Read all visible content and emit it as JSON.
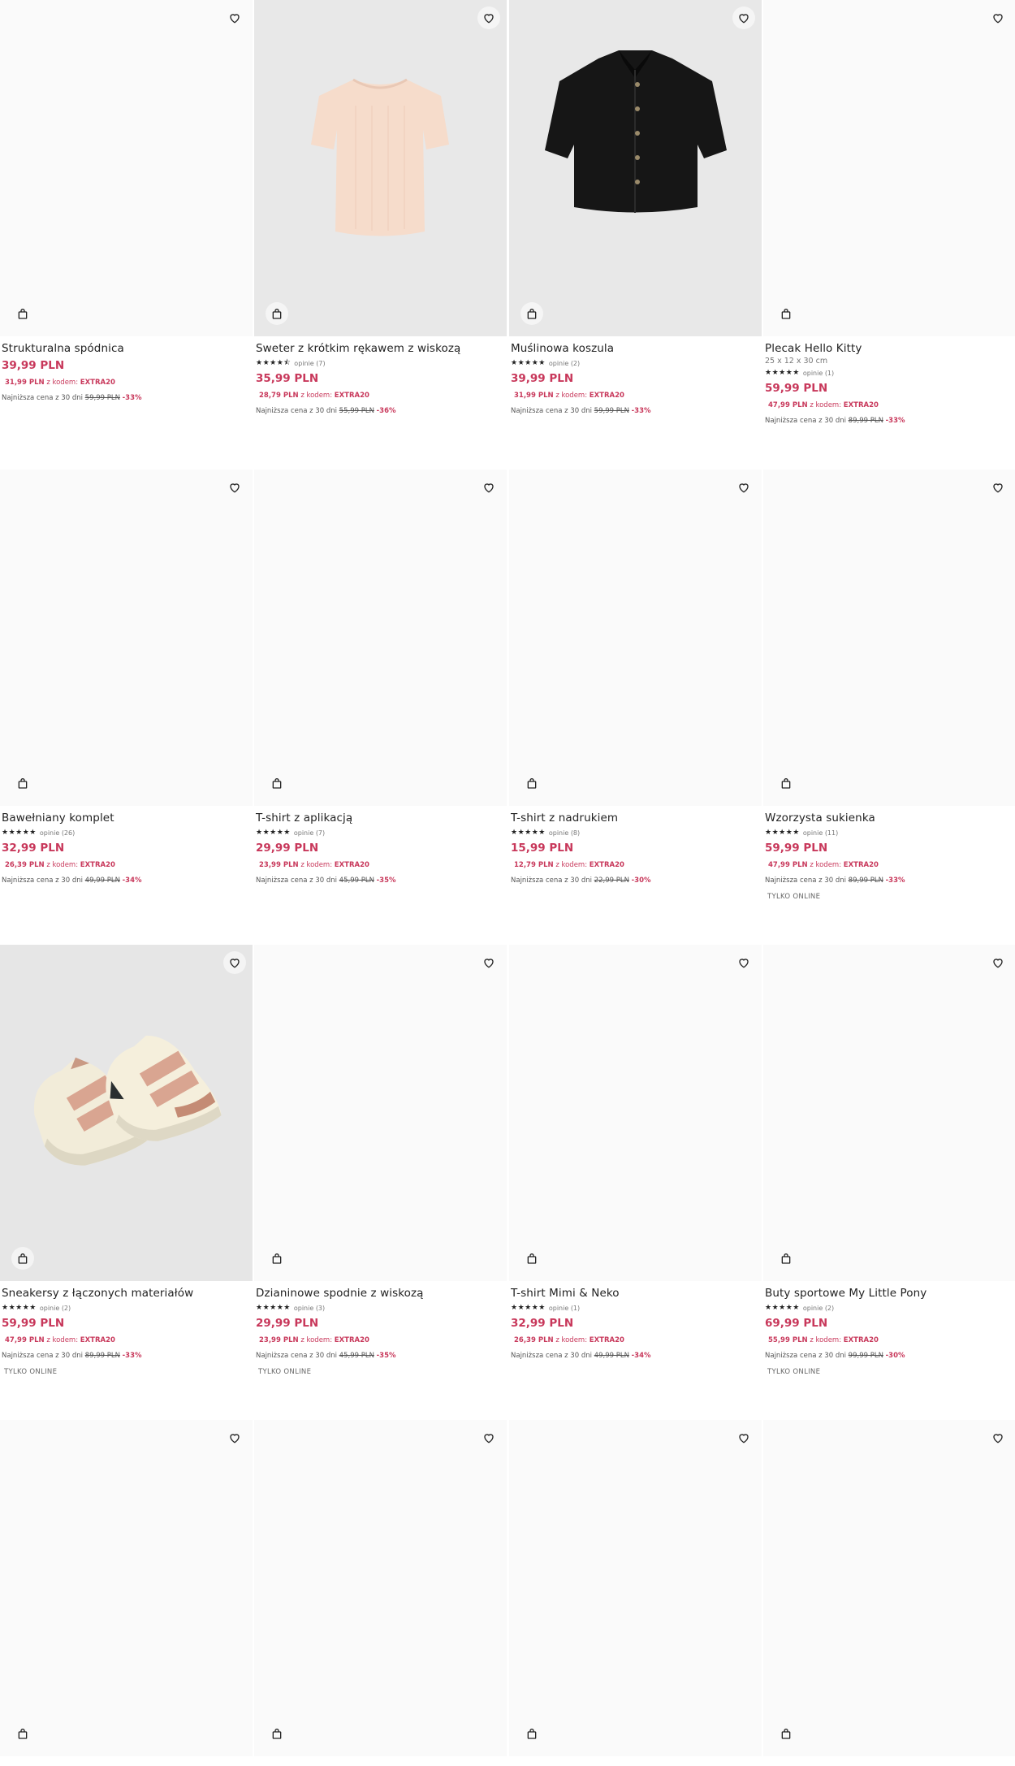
{
  "labels": {
    "reviews_prefix": "opinie",
    "code_prefix": "z kodem:",
    "lowest_prefix": "Najniższa cena z 30 dni",
    "online_only": "TYLKO ONLINE"
  },
  "icons": {
    "favorite": "heart-icon",
    "add_to_bag": "bag-icon"
  },
  "colors": {
    "price": "#c8385b",
    "text": "#222222",
    "muted": "#777777"
  },
  "products": [
    {
      "name": "Strukturalna spódnica",
      "dims": "",
      "stars": "",
      "reviews": "",
      "price": "39,99 PLN",
      "promo_price": "31,99 PLN",
      "code": "EXTRA20",
      "old_price": "59,99 PLN",
      "discount": "-33%",
      "online": ""
    },
    {
      "name": "Sweter z krótkim rękawem z wiskozą",
      "dims": "",
      "stars": "★★★★⯪",
      "reviews": "(7)",
      "price": "35,99 PLN",
      "promo_price": "28,79 PLN",
      "code": "EXTRA20",
      "old_price": "55,99 PLN",
      "discount": "-36%",
      "online": ""
    },
    {
      "name": "Muślinowa koszula",
      "dims": "",
      "stars": "★★★★★",
      "reviews": "(2)",
      "price": "39,99 PLN",
      "promo_price": "31,99 PLN",
      "code": "EXTRA20",
      "old_price": "59,99 PLN",
      "discount": "-33%",
      "online": ""
    },
    {
      "name": "Plecak Hello Kitty",
      "dims": "25 x 12 x 30 cm",
      "stars": "★★★★★",
      "reviews": "(1)",
      "price": "59,99 PLN",
      "promo_price": "47,99 PLN",
      "code": "EXTRA20",
      "old_price": "89,99 PLN",
      "discount": "-33%",
      "online": ""
    },
    {
      "name": "Bawełniany komplet",
      "dims": "",
      "stars": "★★★★★",
      "reviews": "(26)",
      "price": "32,99 PLN",
      "promo_price": "26,39 PLN",
      "code": "EXTRA20",
      "old_price": "49,99 PLN",
      "discount": "-34%",
      "online": ""
    },
    {
      "name": "T-shirt z aplikacją",
      "dims": "",
      "stars": "★★★★★",
      "reviews": "(7)",
      "price": "29,99 PLN",
      "promo_price": "23,99 PLN",
      "code": "EXTRA20",
      "old_price": "45,99 PLN",
      "discount": "-35%",
      "online": ""
    },
    {
      "name": "T-shirt z nadrukiem",
      "dims": "",
      "stars": "★★★★★",
      "reviews": "(8)",
      "price": "15,99 PLN",
      "promo_price": "12,79 PLN",
      "code": "EXTRA20",
      "old_price": "22,99 PLN",
      "discount": "-30%",
      "online": ""
    },
    {
      "name": "Wzorzysta sukienka",
      "dims": "",
      "stars": "★★★★★",
      "reviews": "(11)",
      "price": "59,99 PLN",
      "promo_price": "47,99 PLN",
      "code": "EXTRA20",
      "old_price": "89,99 PLN",
      "discount": "-33%",
      "online": "TYLKO ONLINE"
    },
    {
      "name": "Sneakersy z łączonych materiałów",
      "dims": "",
      "stars": "★★★★★",
      "reviews": "(2)",
      "price": "59,99 PLN",
      "promo_price": "47,99 PLN",
      "code": "EXTRA20",
      "old_price": "89,99 PLN",
      "discount": "-33%",
      "online": "TYLKO ONLINE"
    },
    {
      "name": "Dzianinowe spodnie z wiskozą",
      "dims": "",
      "stars": "★★★★★",
      "reviews": "(3)",
      "price": "29,99 PLN",
      "promo_price": "23,99 PLN",
      "code": "EXTRA20",
      "old_price": "45,99 PLN",
      "discount": "-35%",
      "online": "TYLKO ONLINE"
    },
    {
      "name": "T-shirt Mimi & Neko",
      "dims": "",
      "stars": "★★★★★",
      "reviews": "(1)",
      "price": "32,99 PLN",
      "promo_price": "26,39 PLN",
      "code": "EXTRA20",
      "old_price": "49,99 PLN",
      "discount": "-34%",
      "online": ""
    },
    {
      "name": "Buty sportowe My Little Pony",
      "dims": "",
      "stars": "★★★★★",
      "reviews": "(2)",
      "price": "69,99 PLN",
      "promo_price": "55,99 PLN",
      "code": "EXTRA20",
      "old_price": "99,99 PLN",
      "discount": "-30%",
      "online": "TYLKO ONLINE"
    }
  ]
}
